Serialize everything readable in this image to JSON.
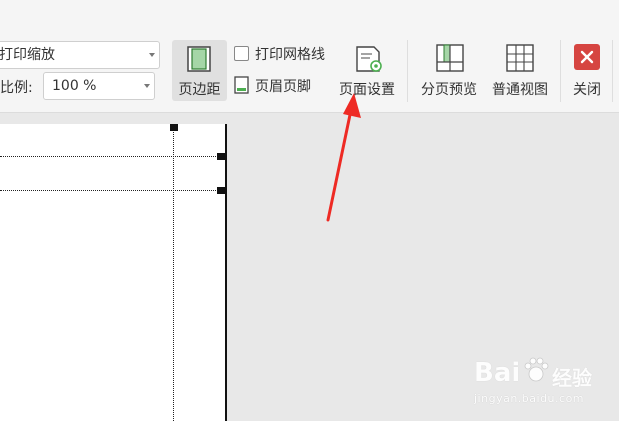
{
  "ribbon": {
    "print_scale_dropdown": "打印缩放",
    "scale_label": "比例:",
    "scale_value": "100 %",
    "margins_button": "页边距",
    "print_gridlines": "打印网格线",
    "header_footer": "页眉页脚",
    "page_setup": "页面设置",
    "page_break_preview": "分页预览",
    "normal_view": "普通视图",
    "close": "关闭"
  },
  "watermark": {
    "brand": "Bai",
    "brand_cn": "经验",
    "url": "jingyan.baidu.com"
  },
  "colors": {
    "accent_red": "#d9272e",
    "close_red": "#d64541",
    "icon_green": "#4caf50"
  }
}
